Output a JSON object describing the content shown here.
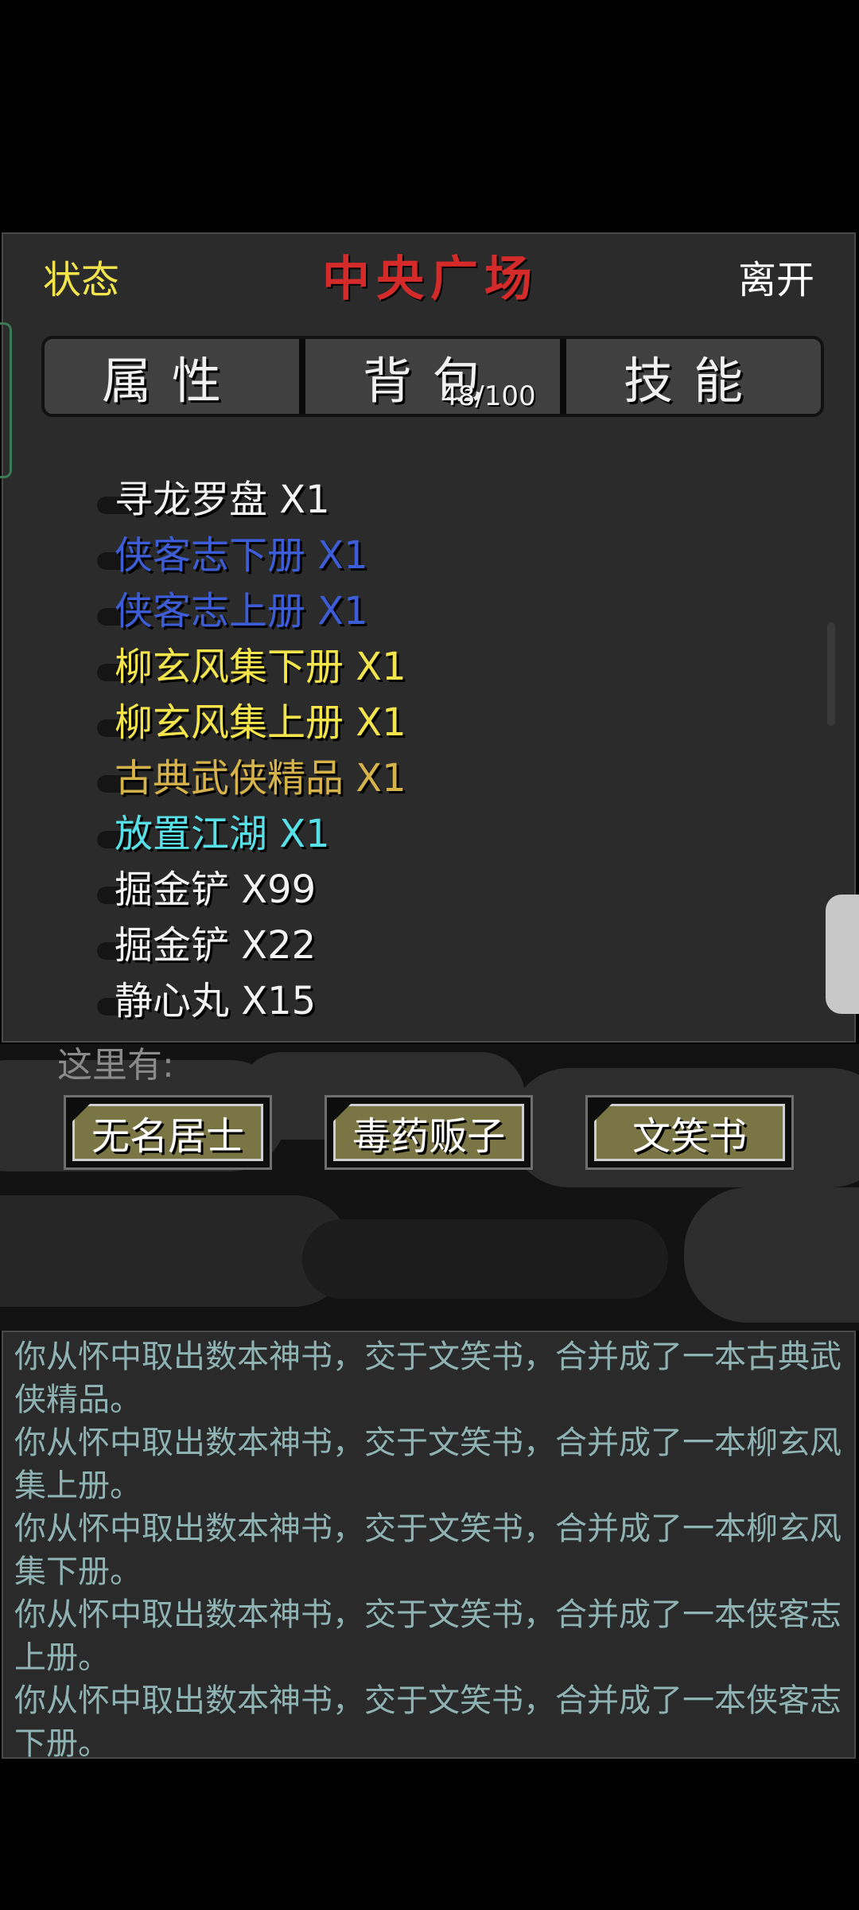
{
  "header": {
    "status_label": "状态",
    "title": "中央广场",
    "leave_label": "离开"
  },
  "tabs": [
    {
      "label": "属性"
    },
    {
      "label": "背包",
      "count": "48/100"
    },
    {
      "label": "技能"
    }
  ],
  "colors": {
    "white": "#f2f2f2",
    "blue": "#3d5dd6",
    "yellow": "#f2e44a",
    "gold": "#d6b24a",
    "cyan": "#58e0e8",
    "title_red": "#d42a2a"
  },
  "inventory": [
    {
      "name": "寻龙罗盘 X1",
      "color": "#f2f2f2"
    },
    {
      "name": "侠客志下册 X1",
      "color": "#3d5dd6"
    },
    {
      "name": "侠客志上册 X1",
      "color": "#3d5dd6"
    },
    {
      "name": "柳玄风集下册 X1",
      "color": "#f2e44a"
    },
    {
      "name": "柳玄风集上册 X1",
      "color": "#f2e44a"
    },
    {
      "name": "古典武侠精品 X1",
      "color": "#d6b24a"
    },
    {
      "name": "放置江湖 X1",
      "color": "#58e0e8"
    },
    {
      "name": "掘金铲 X99",
      "color": "#f2f2f2"
    },
    {
      "name": "掘金铲 X22",
      "color": "#f2f2f2"
    },
    {
      "name": "静心丸 X15",
      "color": "#f2f2f2"
    }
  ],
  "location": {
    "here_label": "这里有:",
    "npcs": [
      {
        "name": "无名居士"
      },
      {
        "name": "毒药贩子"
      },
      {
        "name": "文笑书"
      }
    ]
  },
  "log": [
    "你从怀中取出数本神书，交于文笑书，合并成了一本古典武侠精品。",
    "你从怀中取出数本神书，交于文笑书，合并成了一本柳玄风集上册。",
    "你从怀中取出数本神书，交于文笑书，合并成了一本柳玄风集下册。",
    "你从怀中取出数本神书，交于文笑书，合并成了一本侠客志上册。",
    "你从怀中取出数本神书，交于文笑书，合并成了一本侠客志下册。"
  ]
}
